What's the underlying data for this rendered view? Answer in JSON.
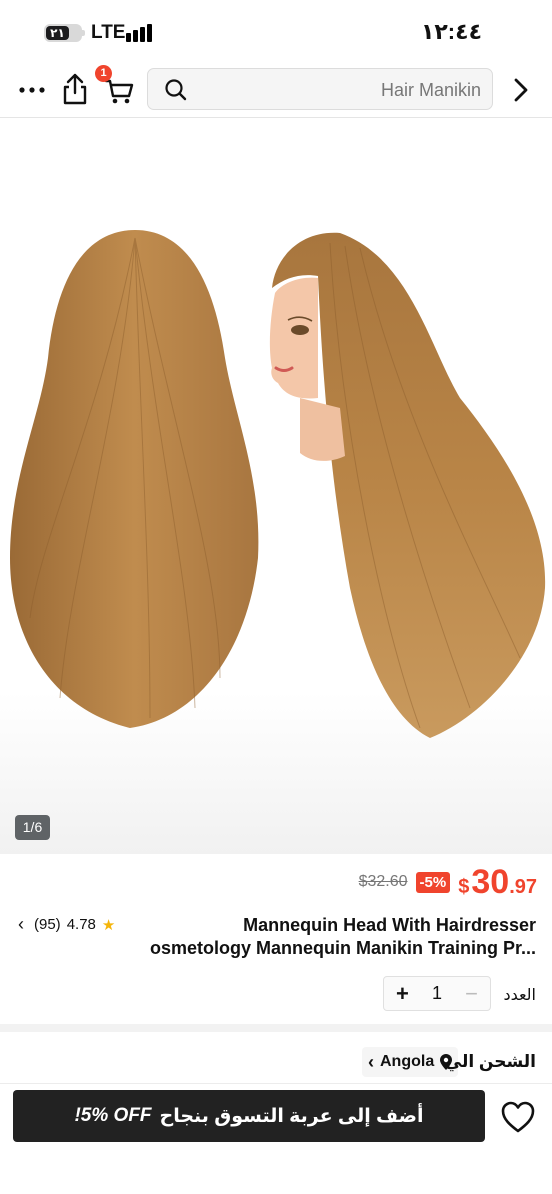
{
  "status_bar": {
    "time": "١٢:٤٤",
    "network": "LTE",
    "battery": "٢١"
  },
  "nav": {
    "cart_count": "1",
    "search_placeholder": "Hair Manikin"
  },
  "gallery": {
    "counter": "1/6"
  },
  "pricing": {
    "currency": "$",
    "price_int": "30",
    "price_dec": ".97",
    "discount": "-5%",
    "old_price": "$32.60"
  },
  "product": {
    "title_line1": "Mannequin Head With Hairdresser",
    "title_line2": "osmetology Mannequin Manikin Training Pr...",
    "rating": "4.78",
    "reviews": "(95)"
  },
  "quantity": {
    "label": "العدد",
    "value": "1"
  },
  "shipping": {
    "label": "الشحن الي",
    "country": "Angola"
  },
  "cta": {
    "label": "أضف إلى عربة التسوق بنجاح",
    "promo": "!5% OFF"
  },
  "colors": {
    "accent": "#f0442d",
    "dark": "#222222",
    "star": "#f5b50a"
  },
  "icons": [
    "more-icon",
    "share-icon",
    "cart-icon",
    "search-icon",
    "chevron-right-icon",
    "location-pin-icon",
    "heart-icon",
    "star-icon"
  ]
}
